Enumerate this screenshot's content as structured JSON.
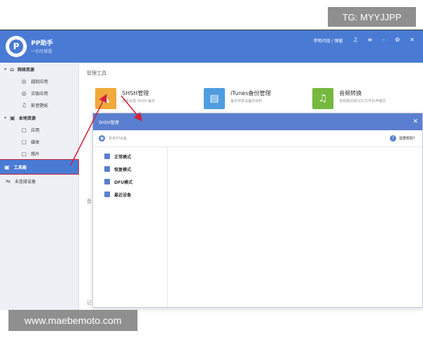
{
  "watermarks": {
    "top": "TG: MYYJJPP",
    "bottom": "www.maebemoto.com"
  },
  "app": {
    "logo_letter": "P",
    "name": "PP助手",
    "subtitle": "一切尽掌握",
    "header": {
      "user_text": "李明闪现 / 弹窗",
      "music_icon": "♫",
      "menu_icon": "≡",
      "minimize": "–",
      "settings": "⚙",
      "close": "✕"
    }
  },
  "sidebar": {
    "groups": [
      {
        "label": "网络资源",
        "icon": "⌂",
        "items": [
          {
            "label": "越狱应用",
            "icon": "◎"
          },
          {
            "label": "正版应用",
            "icon": "◎"
          },
          {
            "label": "影音壁纸",
            "icon": "♫"
          }
        ]
      },
      {
        "label": "本地资源",
        "icon": "▣",
        "items": [
          {
            "label": "应用",
            "icon": "▢"
          },
          {
            "label": "媒体",
            "icon": "▢"
          },
          {
            "label": "照片",
            "icon": "▢"
          }
        ]
      }
    ],
    "active_item": {
      "label": "工具箱",
      "icon": "▣"
    },
    "device_item": {
      "label": "未连接设备",
      "icon": "⇋"
    }
  },
  "main": {
    "title": "管理工具",
    "tools": [
      {
        "name": "SHSH管理",
        "desc": "查看设置 SHSH 备份",
        "icon": "▲",
        "color": "#f0a93a"
      },
      {
        "name": "iTunes备份管理",
        "desc": "备份恢复设备的资料",
        "icon": "▤",
        "color": "#4f9de0"
      },
      {
        "name": "音频转换",
        "desc": "音频格式转DOC文件铃声模式",
        "icon": "♫",
        "color": "#76b83e"
      }
    ],
    "ghost_chars": [
      "备",
      "记"
    ]
  },
  "dialog": {
    "title": "SHSH管理",
    "close": "✕",
    "device_text": "暂未PP设备",
    "device_icon": "◉",
    "help_text": "需要帮助？",
    "help_icon": "?",
    "modes": [
      "正常模式",
      "恢复模式",
      "DFU模式",
      "最近设备"
    ]
  },
  "colors": {
    "title_bar": "#4a7bd4",
    "dialog_header": "#5b7fd0",
    "annotation": "#d0213b"
  }
}
